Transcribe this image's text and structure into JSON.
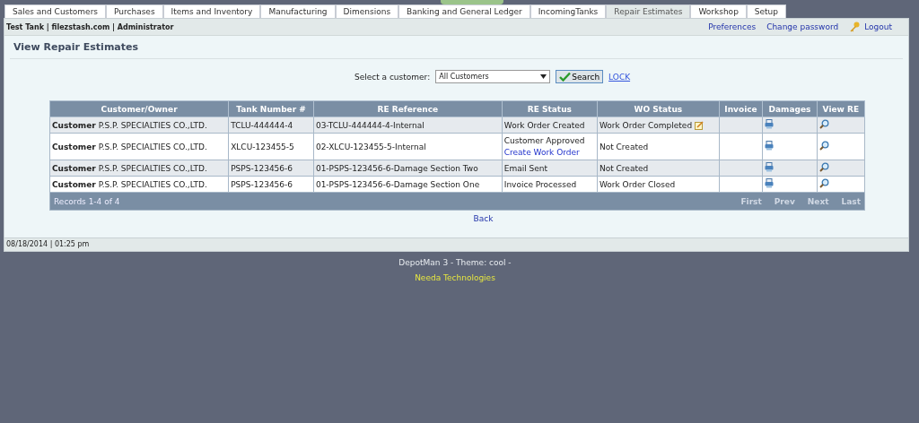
{
  "tabs": [
    {
      "label": "Sales and Customers",
      "selected": false
    },
    {
      "label": "Purchases",
      "selected": false
    },
    {
      "label": "Items and Inventory",
      "selected": false
    },
    {
      "label": "Manufacturing",
      "selected": false
    },
    {
      "label": "Dimensions",
      "selected": false
    },
    {
      "label": "Banking and General Ledger",
      "selected": false
    },
    {
      "label": "IncomingTanks",
      "selected": false
    },
    {
      "label": "Repair Estimates",
      "selected": true
    },
    {
      "label": "Workshop",
      "selected": false
    },
    {
      "label": "Setup",
      "selected": false
    }
  ],
  "user_bar": {
    "info": "Test Tank | filezstash.com | Administrator",
    "links": [
      "Preferences",
      "Change password"
    ],
    "logout": "Logout"
  },
  "page_title": "View Repair Estimates",
  "filter": {
    "label": "Select a customer:",
    "value": "All Customers",
    "button": "Search",
    "link": "LOCK"
  },
  "table": {
    "columns": [
      "Customer/Owner",
      "Tank Number #",
      "RE Reference",
      "RE Status",
      "WO Status",
      "Invoice",
      "Damages",
      "View RE"
    ],
    "rows": [
      {
        "owner_prefix": "Customer",
        "owner": "P.S.P. SPECIALTIES CO.,LTD.",
        "tank": "TCLU-444444-4",
        "reference": "03-TCLU-444444-4-Internal",
        "re_status": "Work Order Created",
        "wo_status": "Work Order Completed",
        "wo_edit_icon": true
      },
      {
        "owner_prefix": "Customer",
        "owner": "P.S.P. SPECIALTIES CO.,LTD.",
        "tank": "XLCU-123455-5",
        "reference": "02-XLCU-123455-5-Internal",
        "re_status": "Customer Approved",
        "re_action": "Create Work Order",
        "wo_status": "Not Created",
        "wo_edit_icon": false
      },
      {
        "owner_prefix": "Customer",
        "owner": "P.S.P. SPECIALTIES CO.,LTD.",
        "tank": "PSPS-123456-6",
        "reference": "01-PSPS-123456-6-Damage Section Two",
        "re_status": "Email Sent",
        "wo_status": "Not Created",
        "wo_edit_icon": false
      },
      {
        "owner_prefix": "Customer",
        "owner": "P.S.P. SPECIALTIES CO.,LTD.",
        "tank": "PSPS-123456-6",
        "reference": "01-PSPS-123456-6-Damage Section One",
        "re_status": "Invoice Processed",
        "wo_status": "Work Order Closed",
        "wo_edit_icon": false
      }
    ],
    "records": "Records 1-4 of 4",
    "pager": [
      "First",
      "Prev",
      "Next",
      "Last"
    ]
  },
  "back": "Back",
  "status_bar": "08/18/2014 | 01:25 pm",
  "footer": {
    "theme": "DepotMan 3 - Theme: cool -",
    "company": "Needa Technologies"
  }
}
